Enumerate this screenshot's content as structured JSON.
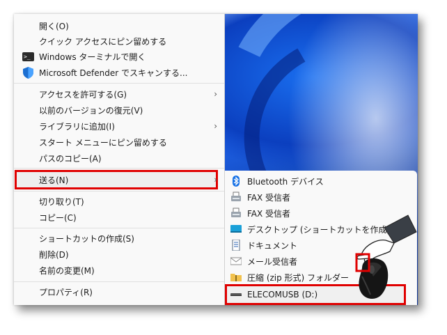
{
  "context_menu": {
    "items": [
      {
        "label": "開く(O)"
      },
      {
        "label": "クイック アクセスにピン留めする"
      },
      {
        "label": "Windows ターミナルで開く",
        "icon": "terminal-icon"
      },
      {
        "label": "Microsoft Defender でスキャンする...",
        "icon": "defender-shield-icon"
      },
      {
        "label": "アクセスを許可する(G)",
        "submenu": true
      },
      {
        "label": "以前のバージョンの復元(V)"
      },
      {
        "label": "ライブラリに追加(I)",
        "submenu": true
      },
      {
        "label": "スタート メニューにピン留めする"
      },
      {
        "label": "パスのコピー(A)"
      },
      {
        "label": "送る(N)",
        "submenu": true,
        "highlighted": true
      },
      {
        "label": "切り取り(T)"
      },
      {
        "label": "コピー(C)"
      },
      {
        "label": "ショートカットの作成(S)"
      },
      {
        "label": "削除(D)"
      },
      {
        "label": "名前の変更(M)"
      },
      {
        "label": "プロパティ(R)"
      }
    ],
    "arrow": "›"
  },
  "send_to_submenu": {
    "items": [
      {
        "label": "Bluetooth デバイス",
        "icon": "bluetooth-icon"
      },
      {
        "label": "FAX 受信者",
        "icon": "fax-icon"
      },
      {
        "label": "FAX 受信者",
        "icon": "fax-icon"
      },
      {
        "label": "デスクトップ (ショートカットを作成)",
        "icon": "desktop-icon"
      },
      {
        "label": "ドキュメント",
        "icon": "documents-icon"
      },
      {
        "label": "メール受信者",
        "icon": "mail-icon"
      },
      {
        "label": "圧縮 (zip 形式) フォルダー",
        "icon": "zip-folder-icon"
      },
      {
        "label": "ELECOMUSB (D:)",
        "icon": "usb-drive-icon",
        "highlighted": true
      }
    ]
  },
  "colors": {
    "highlight_border": "#e00000",
    "menu_bg": "#f9f9f9",
    "wallpaper_blue": "#0b3fbf"
  }
}
